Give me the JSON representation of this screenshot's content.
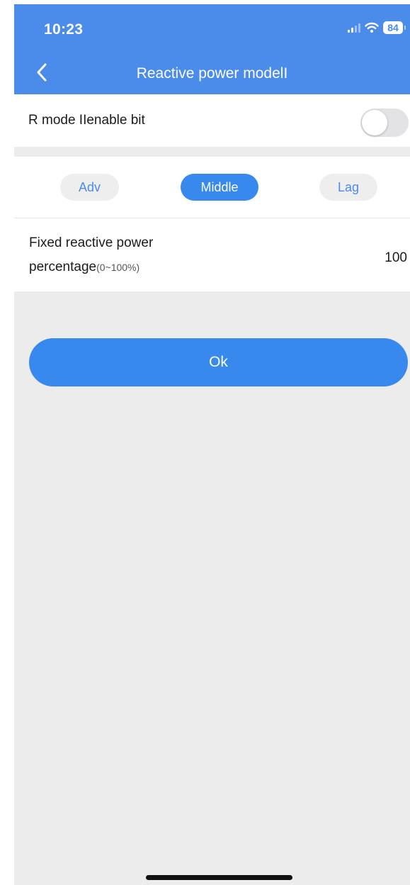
{
  "status_bar": {
    "time": "10:23",
    "battery": "84",
    "icons": [
      "signal-icon",
      "wifi-icon",
      "battery-icon"
    ]
  },
  "header": {
    "title": "Reactive power modelI",
    "back_icon": "chevron-left-icon"
  },
  "enable_row": {
    "label": "R mode IIenable bit",
    "toggle_on": false
  },
  "mode_selector": {
    "options": [
      "Adv",
      "Middle",
      "Lag"
    ],
    "selected": "Middle"
  },
  "percentage_row": {
    "label_line1": "Fixed reactive power",
    "label_line2": "percentage",
    "range": "(0~100%)",
    "value": "100"
  },
  "ok_button": {
    "label": "Ok"
  },
  "colors": {
    "header_bg": "#4b8bea",
    "accent": "#3889ee",
    "page_bg": "#ececec",
    "toggle_off": "#e3e3e6"
  }
}
